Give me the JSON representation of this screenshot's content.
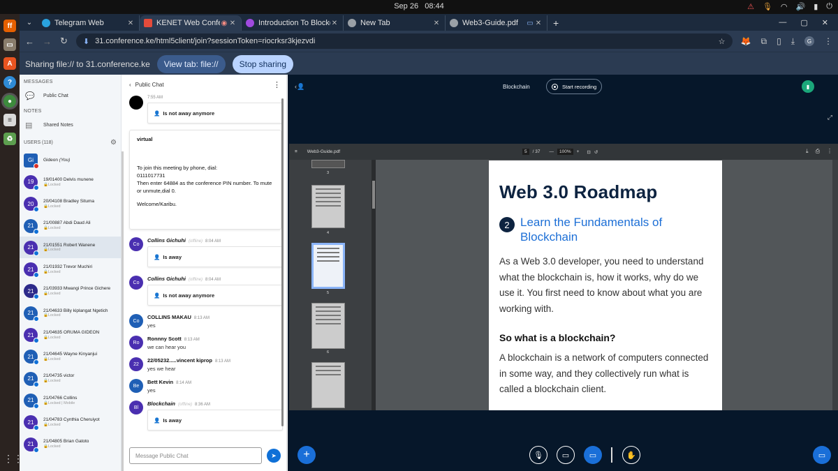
{
  "system": {
    "date": "Sep 26",
    "time": "08:44",
    "tray_icons": [
      "warning-icon",
      "mic-icon",
      "wifi-icon",
      "volume-icon",
      "battery-icon",
      "power-icon"
    ]
  },
  "browser": {
    "tabs": [
      {
        "title": "Telegram Web",
        "favicon_color": "#2aa3df",
        "active": false
      },
      {
        "title": "KENET Web Conferen",
        "favicon_color": "#e44b3b",
        "active": true
      },
      {
        "title": "Introduction To Blockcha",
        "favicon_color": "#a04adf",
        "active": false
      },
      {
        "title": "New Tab",
        "favicon_color": "#9aa0a6",
        "active": false
      },
      {
        "title": "Web3-Guide.pdf",
        "favicon_color": "#9aa0a6",
        "active": false
      }
    ],
    "url": "31.conference.ke/html5client/join?sessionToken=riocrksr3kjezvdi",
    "profile_initial": "G"
  },
  "sharebar": {
    "text": "Sharing file:// to 31.conference.ke",
    "view_tab_label": "View tab: file://",
    "stop_label": "Stop sharing"
  },
  "userlist": {
    "messages_label": "MESSAGES",
    "public_chat_label": "Public Chat",
    "notes_label": "NOTES",
    "shared_notes_label": "Shared Notes",
    "users_label": "USERS (118)",
    "me": {
      "initials": "Gi",
      "name": "Gideon",
      "suffix": "(You)"
    },
    "users": [
      {
        "badge": "19",
        "name": "19/01400 Delvis munene",
        "status": "Locked",
        "color": "#4a2fb0"
      },
      {
        "badge": "20",
        "name": "20/04108 Bradley Situma",
        "status": "Locked",
        "color": "#4a2fb0"
      },
      {
        "badge": "21",
        "name": "21/00887 Abdi Daud Ali",
        "status": "Locked",
        "color": "#1f5fb5"
      },
      {
        "badge": "21",
        "name": "21/01551 Robert Wanene",
        "status": "Locked",
        "color": "#4a2fb0"
      },
      {
        "badge": "21",
        "name": "21/01932 Trevor Muchiri",
        "status": "Locked",
        "color": "#4a2fb0"
      },
      {
        "badge": "21",
        "name": "21/03933 Mwangi Prince Gichere",
        "status": "Locked",
        "color": "#2d2a8a"
      },
      {
        "badge": "21",
        "name": "21/04633 Billy kiplangat Ngetich",
        "status": "Locked",
        "color": "#1f5fb5"
      },
      {
        "badge": "21",
        "name": "21/04635 ORUMA GIDEON",
        "status": "Locked",
        "color": "#4a2fb0"
      },
      {
        "badge": "21",
        "name": "21/04645 Wayne Kinyanjui",
        "status": "Locked",
        "color": "#1f5fb5"
      },
      {
        "badge": "21",
        "name": "21/04735 victor",
        "status": "Locked",
        "color": "#1f5fb5"
      },
      {
        "badge": "21",
        "name": "21/04766 Collins",
        "status": "Locked | Mobile",
        "color": "#1f5fb5"
      },
      {
        "badge": "21",
        "name": "21/04783 Cynthia Cheruiyot",
        "status": "Locked",
        "color": "#4a2fb0"
      },
      {
        "badge": "21",
        "name": "21/04805 Brian Gatoto",
        "status": "Locked",
        "color": "#4a2fb0"
      }
    ]
  },
  "chat": {
    "title": "Public Chat",
    "first_time": "7:55 AM",
    "first_status": "Is not away anymore",
    "welcome": {
      "heading": "virtual",
      "line1": "To join this meeting by phone, dial:",
      "line2": "0111017731",
      "line3": "Then enter 64884 as the conference PIN number. To mute or unmute,dial 0.",
      "line4": "Welcome/Karibu."
    },
    "messages": [
      {
        "initials": "Co",
        "color": "#4a2fb0",
        "name": "Collins Gichuhi",
        "offline": "(offline)",
        "time": "8:04 AM",
        "status": "Is away"
      },
      {
        "initials": "Co",
        "color": "#4a2fb0",
        "name": "Collins Gichuhi",
        "offline": "(offline)",
        "time": "8:04 AM",
        "status": "Is not away anymore"
      },
      {
        "initials": "Co",
        "color": "#1f5fb5",
        "name": "COLLINS MAKAU",
        "time": "8:13 AM",
        "text": "yes"
      },
      {
        "initials": "Ro",
        "color": "#4a2fb0",
        "name": "Ronnny Scott",
        "time": "8:13 AM",
        "text": "we can hear you"
      },
      {
        "initials": "22",
        "color": "#4a2fb0",
        "name": "22/05232.....vincent kiprop",
        "time": "8:13 AM",
        "text": "yes we hear"
      },
      {
        "initials": "Be",
        "color": "#1f5fb5",
        "name": "Bett Kevin",
        "time": "8:14 AM",
        "text": "yes"
      },
      {
        "initials": "Bl",
        "color": "#4a2fb0",
        "name": "Blockchain",
        "offline": "(offline)",
        "time": "8:36 AM",
        "status": "Is away"
      }
    ],
    "input_placeholder": "Message Public Chat"
  },
  "main": {
    "presentation_title": "Blockchain",
    "record_label": "Start recording",
    "pdf": {
      "file_name": "Web3-Guide.pdf",
      "current_page": "5",
      "total_pages": "/ 37",
      "zoom": "100%",
      "thumb_numbers": [
        "3",
        "4",
        "5",
        "6"
      ],
      "page_heading": "Web 3.0 Roadmap",
      "section_number": "2",
      "section_title": "Learn the Fundamentals of Blockchain",
      "para1": "As a Web 3.0 developer, you need to understand what the blockchain is, how it works, why do we use it. You first need to know about what you are working with.",
      "subheading": "So what is a blockchain?",
      "para2": "A blockchain is a network of computers connected in some way, and they collectively run what is called a blockchain client."
    }
  }
}
